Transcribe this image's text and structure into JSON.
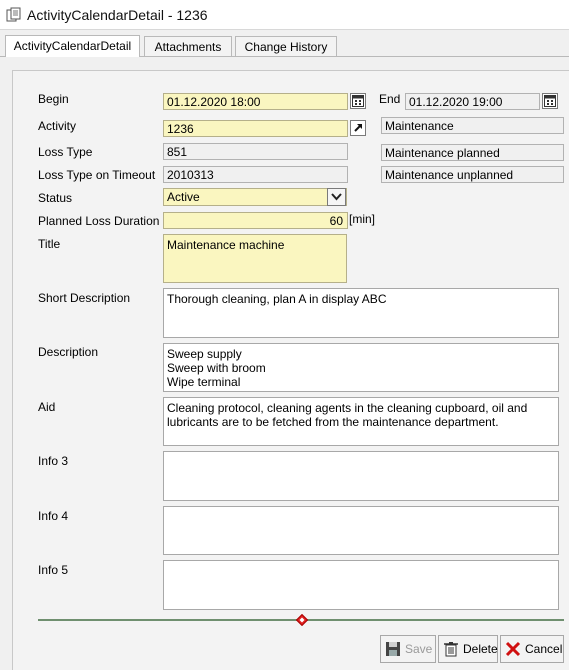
{
  "window": {
    "title": "ActivityCalendarDetail - 1236"
  },
  "tabs": [
    {
      "label": "ActivityCalendarDetail"
    },
    {
      "label": "Attachments"
    },
    {
      "label": "Change History"
    }
  ],
  "form": {
    "begin_label": "Begin",
    "begin_value": "01.12.2020 18:00",
    "end_label": "End",
    "end_value": "01.12.2020 19:00",
    "activity_label": "Activity",
    "activity_value": "1236",
    "activity_desc": "Maintenance",
    "loss_type_label": "Loss Type",
    "loss_type_value": "851",
    "loss_type_desc": "Maintenance planned",
    "loss_type_timeout_label": "Loss Type on Timeout",
    "loss_type_timeout_value": "2010313",
    "loss_type_timeout_desc": "Maintenance unplanned",
    "status_label": "Status",
    "status_value": "Active",
    "planned_loss_label": "Planned Loss Duration",
    "planned_loss_value": "60",
    "planned_loss_unit": "[min]",
    "title_label": "Title",
    "title_value": "Maintenance machine",
    "short_desc_label": "Short Description",
    "short_desc_value": "Thorough cleaning, plan A in display ABC",
    "description_label": "Description",
    "description_lines": [
      "Sweep supply",
      "Sweep with broom",
      "Wipe terminal"
    ],
    "aid_label": "Aid",
    "aid_lines": [
      "Cleaning protocol, cleaning agents in the cleaning cupboard, oil and",
      "lubricants are to be fetched from the maintenance department."
    ],
    "info3_label": "Info 3",
    "info4_label": "Info 4",
    "info5_label": "Info 5"
  },
  "buttons": {
    "save": "Save",
    "delete": "Delete",
    "cancel": "Cancel"
  },
  "colors": {
    "mandatory_field": "#faf6c0",
    "splitter": "#6f8f6f",
    "splitter_handle": "#e02020",
    "cancel_icon": "#d01010"
  }
}
